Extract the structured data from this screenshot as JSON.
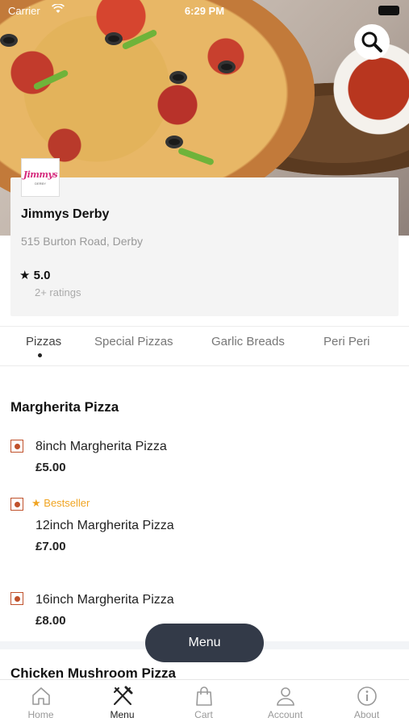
{
  "status_bar": {
    "carrier": "Carrier",
    "time": "6:29 PM"
  },
  "restaurant": {
    "logo_text": "Jimmys",
    "logo_subtext": "DERBY",
    "name": "Jimmys Derby",
    "address": "515 Burton Road, Derby",
    "rating": "5.0",
    "rating_count": "2+ ratings"
  },
  "tabs": [
    {
      "label": "Pizzas",
      "active": true
    },
    {
      "label": "Special Pizzas",
      "active": false
    },
    {
      "label": "Garlic Breads",
      "active": false
    },
    {
      "label": "Peri Peri",
      "active": false
    }
  ],
  "sections": [
    {
      "title": "Margherita Pizza",
      "items": [
        {
          "name": "8inch Margherita Pizza",
          "price": "£5.00",
          "badge": ""
        },
        {
          "name": "12inch Margherita Pizza",
          "price": "£7.00",
          "badge": "Bestseller"
        },
        {
          "name": "16inch Margherita Pizza",
          "price": "£8.00",
          "badge": ""
        }
      ]
    },
    {
      "title": "Chicken Mushroom Pizza",
      "items": []
    }
  ],
  "menu_button": {
    "label": "Menu"
  },
  "bottom_nav": [
    {
      "label": "Home",
      "icon": "home-icon",
      "active": false
    },
    {
      "label": "Menu",
      "icon": "fork-knife-icon",
      "active": true
    },
    {
      "label": "Cart",
      "icon": "bag-icon",
      "active": false
    },
    {
      "label": "Account",
      "icon": "user-icon",
      "active": false
    },
    {
      "label": "About",
      "icon": "info-icon",
      "active": false
    }
  ],
  "colors": {
    "accent": "#c0512b",
    "bestseller": "#f0a422",
    "fab_background": "#333a48"
  }
}
